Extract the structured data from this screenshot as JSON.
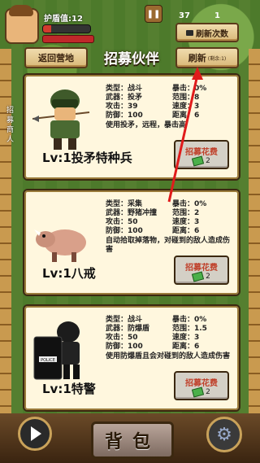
{
  "hud": {
    "hp_label": "护盾值:12",
    "stat_37": "37",
    "stat_right": "1"
  },
  "header": {
    "title": "招募伙伴",
    "back_label": "返回营地",
    "refresh_count_label": "刷新次数",
    "refresh_label": "刷新",
    "refresh_sub": "(剩余:1)"
  },
  "side_text": "招募商人",
  "cards": [
    {
      "level_name": "Lv:1投矛特种兵",
      "type": "类型：战斗",
      "weapon": "武器：投矛",
      "attack": "攻击：39",
      "defense": "防御：100",
      "crit": "暴击：0%",
      "range": "范围：8",
      "speed": "速度：3",
      "hit": "距离：6",
      "desc": "使用投矛，远程，暴击高",
      "cost_label": "招募花费",
      "cost_value": "2"
    },
    {
      "level_name": "Lv:1八戒",
      "type": "类型：采集",
      "weapon": "武器：野猪冲撞",
      "attack": "攻击：50",
      "defense": "防御：100",
      "crit": "暴击：0%",
      "range": "范围：2",
      "speed": "速度：3",
      "hit": "距离：6",
      "desc": "自动拾取掉落物，对碰到的敌人造成伤害",
      "cost_label": "招募花费",
      "cost_value": "2"
    },
    {
      "level_name": "Lv:1特警",
      "type": "类型：战斗",
      "weapon": "武器：防爆盾",
      "attack": "攻击：50",
      "defense": "防御：100",
      "crit": "暴击：0%",
      "range": "范围：1.5",
      "speed": "速度：3",
      "hit": "距离：6",
      "desc": "使用防爆盾且会对碰到的敌人造成伤害",
      "cost_label": "招募花费",
      "cost_value": "2"
    }
  ],
  "bottom": {
    "bag_label": "背包"
  },
  "colors": {
    "accent_red": "#e01b1b",
    "card_bg": "#fff7de",
    "brown": "#5a3a1a"
  }
}
